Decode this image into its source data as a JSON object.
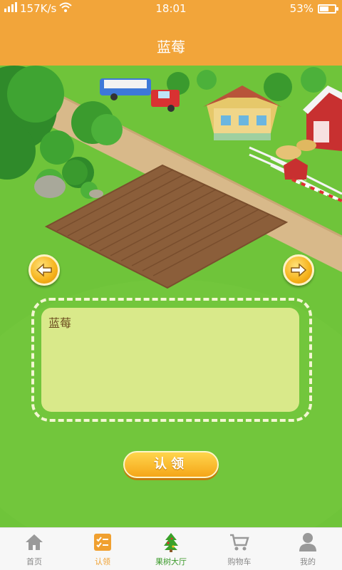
{
  "status_bar": {
    "network_speed": "157K/s",
    "time": "18:01",
    "battery": "53%",
    "battery_level": 0.53
  },
  "header": {
    "title": "蓝莓"
  },
  "scene": {
    "prev_icon": "arrow-left-icon",
    "next_icon": "arrow-right-icon"
  },
  "info": {
    "name": "蓝莓"
  },
  "claim_button": {
    "label": "认领"
  },
  "tabbar": {
    "items": [
      {
        "label": "首页",
        "icon": "home-icon"
      },
      {
        "label": "认领",
        "icon": "claim-list-icon"
      },
      {
        "label": "果树大厅",
        "icon": "tree-icon"
      },
      {
        "label": "购物车",
        "icon": "cart-icon"
      },
      {
        "label": "我的",
        "icon": "user-icon"
      }
    ],
    "active_index": 1
  },
  "colors": {
    "header": "#f2a53a",
    "grass": "#6fc43a",
    "active_tab": "#f0a030"
  }
}
